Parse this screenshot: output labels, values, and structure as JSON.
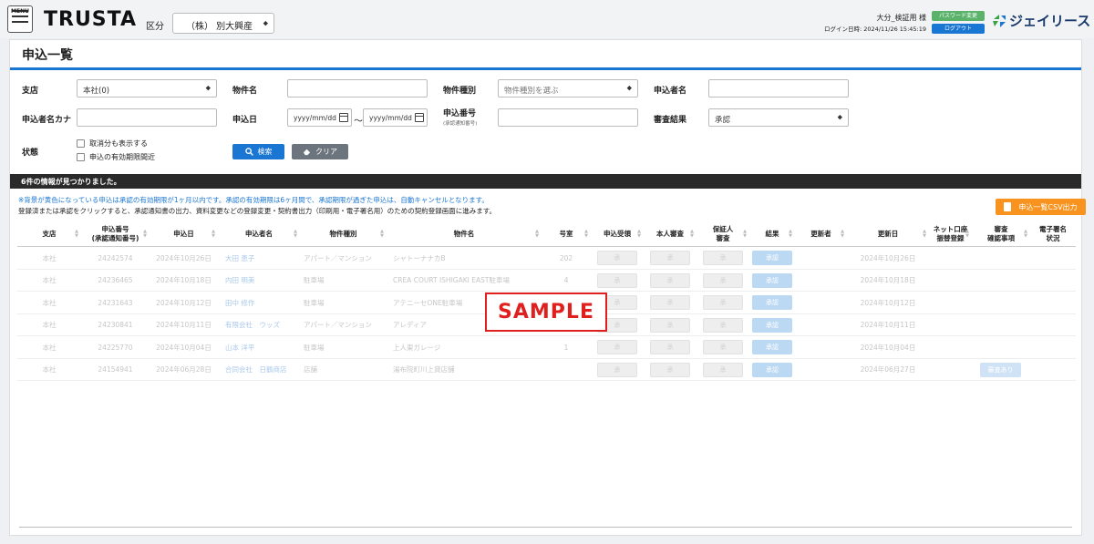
{
  "header": {
    "menu_label": "MENU",
    "logo": "TRUSTA",
    "kubun_label": "区分",
    "kubun_value": "（株） 別大興産",
    "user_name": "大分_検証用 様",
    "login_datetime": "ログイン日時: 2024/11/26 15:45:19",
    "password_button": "パスワード変更",
    "logout_button": "ログアウト",
    "brand_name": "ジェイリース"
  },
  "page": {
    "title": "申込一覧"
  },
  "filters": {
    "branch_label": "支店",
    "branch_value": "本社(0)",
    "property_name_label": "物件名",
    "property_type_label": "物件種別",
    "property_type_value": "物件種別を選ぶ",
    "applicant_name_label": "申込者名",
    "applicant_kana_label": "申込者名カナ",
    "apply_date_label": "申込日",
    "date_from_placeholder": "yyyy/mm/dd",
    "date_to_placeholder": "yyyy/mm/dd",
    "date_separator": "～",
    "apply_number_label": "申込番号",
    "apply_number_sublabel": "(承認通知番号)",
    "review_result_label": "審査結果",
    "review_result_value": "承認",
    "status_label": "状態",
    "show_cancelled": "取消分も表示する",
    "expiry_near": "申込の有効期限間近",
    "search_button": "検索",
    "clear_button": "クリア"
  },
  "results": {
    "count_text": "6件の情報が見つかりました。",
    "note_yellow": "※背景が黄色になっている申込は承認の有効期限が1ヶ月以内です。承認の有効期限は6ヶ月間で、承認期限が過ぎた申込は、自動キャンセルとなります。",
    "note_click": "登録済または承認をクリックすると、承認通知書の出力、資料変更などの登録変更・契約書出力（印刷用・電子署名用）のための契約登録画面に進みます。",
    "csv_button": "申込一覧CSV出力"
  },
  "table": {
    "headers": {
      "branch": "支店",
      "number_l1": "申込番号",
      "number_l2": "(承認通知番号)",
      "date": "申込日",
      "applicant": "申込者名",
      "type": "物件種別",
      "property": "物件名",
      "room": "号室",
      "reception": "申込受領",
      "self_review": "本人審査",
      "guarantor_l1": "保証人",
      "guarantor_l2": "審査",
      "result": "結果",
      "updater": "更新者",
      "updated": "更新日",
      "net_l1": "ネット口座",
      "net_l2": "振替登録",
      "check_l1": "審査",
      "check_l2": "確認事項",
      "esign_l1": "電子署名",
      "esign_l2": "状況"
    },
    "rows": [
      {
        "branch": "本社",
        "number": "24242574",
        "date": "2024年10月26日",
        "applicant": "大田 恵子",
        "type": "アパート／マンション",
        "property": "シャトーナナカB",
        "room": "202",
        "reception": "承",
        "self_review": "承",
        "guarantor": "承",
        "result": "承認",
        "updated": "2024年10月26日",
        "check": ""
      },
      {
        "branch": "本社",
        "number": "24236465",
        "date": "2024年10月18日",
        "applicant": "内田 明美",
        "type": "駐車場",
        "property": "CREA COURT ISHIGAKI EAST駐車場",
        "room": "4",
        "reception": "承",
        "self_review": "承",
        "guarantor": "承",
        "result": "承認",
        "updated": "2024年10月18日",
        "check": ""
      },
      {
        "branch": "本社",
        "number": "24231643",
        "date": "2024年10月12日",
        "applicant": "田中 修作",
        "type": "駐車場",
        "property": "アテニーセONE駐車場",
        "room": "",
        "reception": "承",
        "self_review": "承",
        "guarantor": "承",
        "result": "承認",
        "updated": "2024年10月12日",
        "check": ""
      },
      {
        "branch": "本社",
        "number": "24230841",
        "date": "2024年10月11日",
        "applicant": "有限会社　ウッズ",
        "type": "アパート／マンション",
        "property": "アレディア",
        "room": "",
        "reception": "承",
        "self_review": "承",
        "guarantor": "承",
        "result": "承認",
        "updated": "2024年10月11日",
        "check": ""
      },
      {
        "branch": "本社",
        "number": "24225770",
        "date": "2024年10月04日",
        "applicant": "山本 洋平",
        "type": "駐車場",
        "property": "上人東ガレージ",
        "room": "1",
        "reception": "承",
        "self_review": "承",
        "guarantor": "承",
        "result": "承認",
        "updated": "2024年10月04日",
        "check": ""
      },
      {
        "branch": "本社",
        "number": "24154941",
        "date": "2024年06月28日",
        "applicant": "合同会社　日鶴商店",
        "type": "店舗",
        "property": "湯布院町川上貸店舗",
        "room": "",
        "reception": "承",
        "self_review": "承",
        "guarantor": "承",
        "result": "承認",
        "updated": "2024年06月27日",
        "check": "審査あり"
      }
    ]
  },
  "watermark": "SAMPLE",
  "colors": {
    "accent": "#1976d2",
    "csv": "#f7931e",
    "password": "#5bb36b",
    "stamp": "#e0201e"
  }
}
